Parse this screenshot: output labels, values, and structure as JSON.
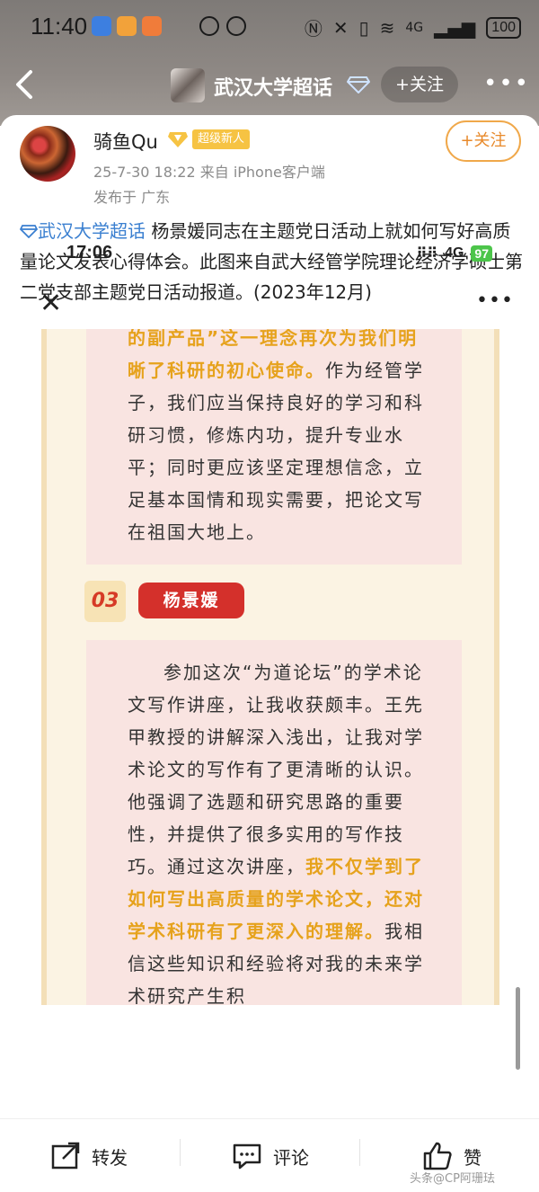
{
  "status_bar": {
    "time": "11:40",
    "battery": "100",
    "network": "4G"
  },
  "nav": {
    "topic_title": "武汉大学超话",
    "follow_label": "+关注"
  },
  "post": {
    "author": "骑鱼Qu",
    "badge": "超级新人",
    "meta": "25-7-30 18:22  来自 iPhone客户端",
    "location": "发布于 广东",
    "follow_label": "+关注",
    "topic_link": "武汉大学超话",
    "text": "  杨景媛同志在主题党日活动上就如何写好高质量论文发表心得体会。此图来自武大经管学院理论经济学硕士第二党支部主题党日活动报道。(2023年12月)"
  },
  "embedded": {
    "time": "17:06",
    "network": "4G",
    "battery": "97",
    "para1_hl": "的副产品”这一理念再次为我们明晰了科研的初心使命。",
    "para1_rest": "作为经管学子，我们应当保持良好的学习和科研习惯，修炼内功，提升专业水平；同时更应该坚定理想信念，立足基本国情和现实需要，把论文写在祖国大地上。",
    "section_number": "03",
    "section_name": "杨景媛",
    "para2_start": "参加这次“为道论坛”的学术论文写作讲座，让我收获颇丰。王先甲教授的讲解深入浅出，让我对学术论文的写作有了更清晰的认识。他强调了选题和研究思路的重要性，并提供了很多实用的写作技巧。通过这次讲座，",
    "para2_hl": "我不仅学到了如何写出高质量的学术论文，还对学术科研有了更深入的理解。",
    "para2_end": "我相信这些知识和经验将对我的未来学术研究产生积"
  },
  "bottom_bar": {
    "repost": "转发",
    "comment": "评论",
    "like": "赞"
  },
  "watermark": "头条@CP阿珊珐",
  "colors": {
    "accent_orange": "#e8892a",
    "topic_blue": "#3a7fd0",
    "highlight_gold": "#e6a21c",
    "name_red": "#d4302b"
  }
}
